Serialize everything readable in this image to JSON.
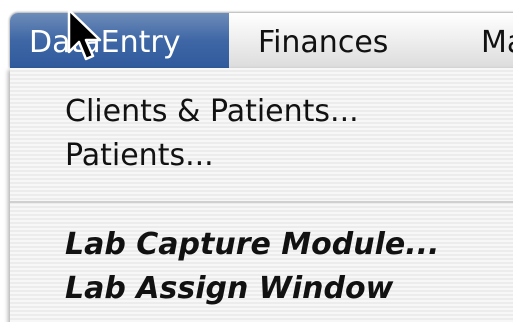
{
  "menubar": {
    "titles": [
      "DataEntry",
      "Finances",
      "Ma"
    ]
  },
  "dropdown": {
    "items": [
      {
        "label": "Clients & Patients..."
      },
      {
        "label": "Patients..."
      },
      {
        "label": "Lab Capture Module..."
      },
      {
        "label": "Lab Assign Window"
      }
    ]
  },
  "colors": {
    "highlight": "#3f67a6",
    "menu_text": "#111111"
  },
  "icons": {
    "cursor": "arrow-pointer-icon"
  }
}
